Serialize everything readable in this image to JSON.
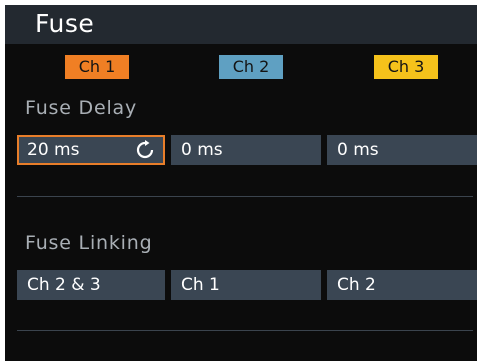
{
  "title": "Fuse",
  "channels": [
    {
      "label": "Ch 1",
      "color": "#f07f24"
    },
    {
      "label": "Ch 2",
      "color": "#5fa0c2"
    },
    {
      "label": "Ch 3",
      "color": "#f5c21b"
    }
  ],
  "fuse_delay": {
    "heading": "Fuse Delay",
    "values": [
      "20 ms",
      "0 ms",
      "0 ms"
    ]
  },
  "fuse_linking": {
    "heading": "Fuse Linking",
    "values": [
      "Ch 2 & 3",
      "Ch 1",
      "Ch 2"
    ]
  },
  "colors": {
    "background": "#0c0c0c",
    "title_bar": "#232930",
    "field": "#3a4653",
    "selected_border": "#e87e2a",
    "heading_text": "#a9afb5"
  },
  "icons": {
    "fuse_delay_ch1": "refresh-icon"
  }
}
